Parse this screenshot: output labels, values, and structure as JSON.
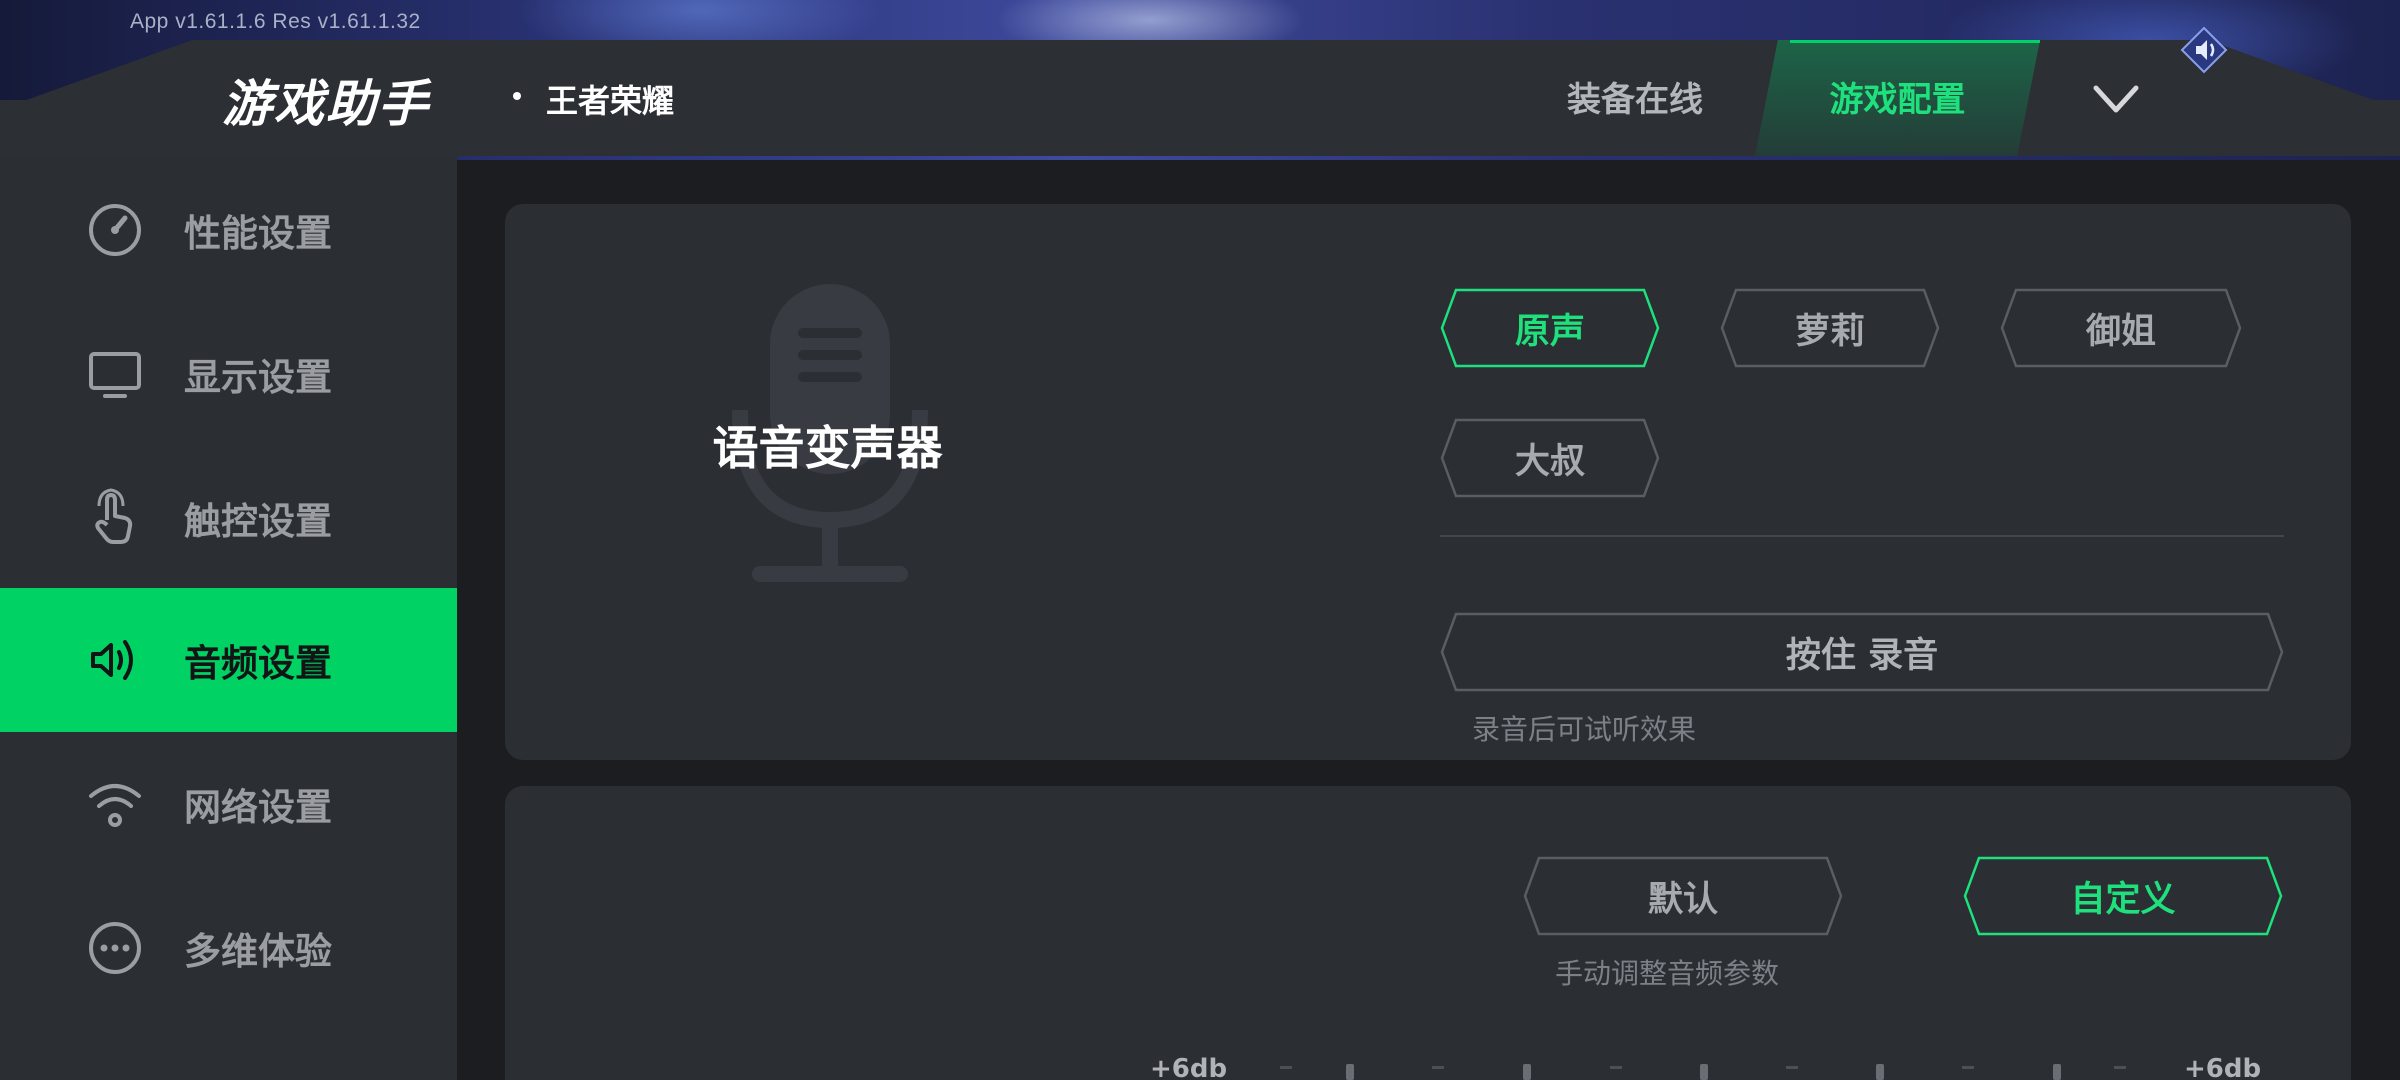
{
  "version": "App v1.61.1.6    Res v1.61.1.32",
  "header": {
    "logo": "游戏助手",
    "game_name": "王者荣耀",
    "tabs": [
      {
        "label": "装备在线",
        "active": false
      },
      {
        "label": "游戏配置",
        "active": true
      }
    ],
    "expand_icon": "chevron-down-icon"
  },
  "sidebar": {
    "items": [
      {
        "label": "性能设置",
        "icon": "gauge-icon",
        "active": false
      },
      {
        "label": "显示设置",
        "icon": "monitor-icon",
        "active": false
      },
      {
        "label": "触控设置",
        "icon": "touch-hand-icon",
        "active": false
      },
      {
        "label": "音频设置",
        "icon": "speaker-icon",
        "active": true
      },
      {
        "label": "网络设置",
        "icon": "wifi-icon",
        "active": false
      },
      {
        "label": "多维体验",
        "icon": "more-dots-icon",
        "active": false
      }
    ]
  },
  "voice_changer": {
    "title": "语音变声器",
    "options": [
      {
        "label": "原声",
        "selected": true
      },
      {
        "label": "萝莉",
        "selected": false
      },
      {
        "label": "御姐",
        "selected": false
      },
      {
        "label": "大叔",
        "selected": false
      }
    ],
    "record_button": "按住  录音",
    "record_hint": "录音后可试听效果"
  },
  "equalizer": {
    "modes": [
      {
        "label": "默认",
        "selected": false
      },
      {
        "label": "自定义",
        "selected": true
      }
    ],
    "hint": "手动调整音频参数",
    "left_label": "+6db",
    "right_label": "+6db"
  },
  "colors": {
    "accent": "#00d264",
    "accent_text": "#1ee07c",
    "panel": "#2b2e33",
    "background": "#1b1d20"
  }
}
